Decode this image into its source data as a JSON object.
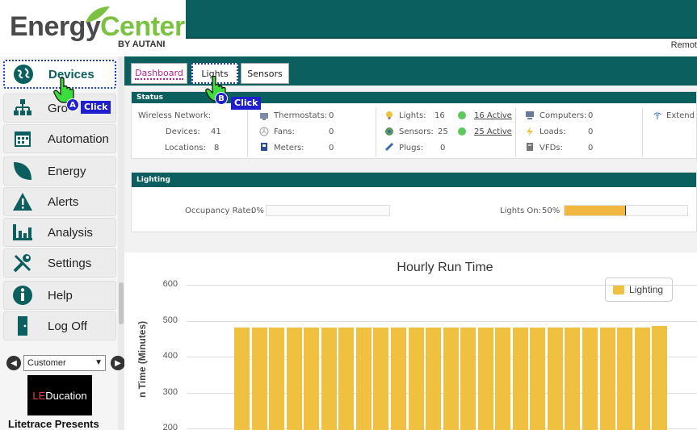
{
  "header": {
    "logo_energy": "Energy",
    "logo_center": "Center",
    "logo_by": "BY AUTANI",
    "remote_text": "Remot"
  },
  "sidebar": {
    "items": [
      {
        "label": "Devices",
        "icon": "globe-icon"
      },
      {
        "label": "Gro",
        "icon": "groups-icon"
      },
      {
        "label": "Automation",
        "icon": "calendar-icon"
      },
      {
        "label": "Energy",
        "icon": "leaf-icon"
      },
      {
        "label": "Alerts",
        "icon": "warning-icon"
      },
      {
        "label": "Analysis",
        "icon": "bar-chart-icon"
      },
      {
        "label": "Settings",
        "icon": "tools-icon"
      },
      {
        "label": "Help",
        "icon": "info-icon"
      },
      {
        "label": "Log Off",
        "icon": "door-icon"
      }
    ],
    "customer_select": "Customer",
    "led_logo_le": "LE",
    "led_logo_rest": "Ducation",
    "litetrace": "Litetrace Presents"
  },
  "tabs": {
    "dashboard": "Dashboard",
    "lights": "Lights",
    "sensors": "Sensors"
  },
  "status": {
    "header": "Status",
    "wireless_network": "Wireless Network:",
    "devices_label": "Devices:",
    "devices_value": "41",
    "locations_label": "Locations:",
    "locations_value": "8",
    "thermostats_label": "Thermostats:",
    "thermostats_value": "0",
    "fans_label": "Fans:",
    "fans_value": "0",
    "meters_label": "Meters:",
    "meters_value": "0",
    "lights_label": "Lights:",
    "lights_value": "16",
    "lights_active": "16 Active",
    "sensors_label": "Sensors:",
    "sensors_value": "25",
    "sensors_active": "25 Active",
    "plugs_label": "Plugs:",
    "plugs_value": "0",
    "computers_label": "Computers:",
    "computers_value": "0",
    "loads_label": "Loads:",
    "loads_value": "0",
    "vfds_label": "VFDs:",
    "vfds_value": "0",
    "extend": "Extend"
  },
  "lighting": {
    "header": "Lighting",
    "occupancy_label": "Occupancy Rate:",
    "occupancy_value": "0%",
    "occupancy_fraction": 0,
    "lights_on_label": "Lights On:",
    "lights_on_value": "50%",
    "lights_on_fraction": 0.5
  },
  "annotations": {
    "a_badge": "A",
    "b_badge": "B",
    "click_label": "Click"
  },
  "colors": {
    "teal": "#0b5f5f",
    "bar": "#f0c040",
    "green_logo": "#7cc242",
    "annotation_blue": "#1f1fd0"
  },
  "chart_data": {
    "type": "bar",
    "title": "Hourly Run Time",
    "ylabel": "Run Time (Minutes)",
    "ylabel_visible": "n Time (Minutes)",
    "legend": "top-right",
    "ylim": [
      200,
      600
    ],
    "yticks": [
      "600",
      "500",
      "400",
      "300",
      "200"
    ],
    "series": [
      {
        "name": "Lighting",
        "values": [
          480,
          480,
          480,
          480,
          480,
          480,
          480,
          480,
          480,
          480,
          480,
          480,
          480,
          480,
          480,
          480,
          480,
          480,
          480,
          480,
          480,
          480,
          480,
          480,
          485
        ]
      }
    ]
  }
}
